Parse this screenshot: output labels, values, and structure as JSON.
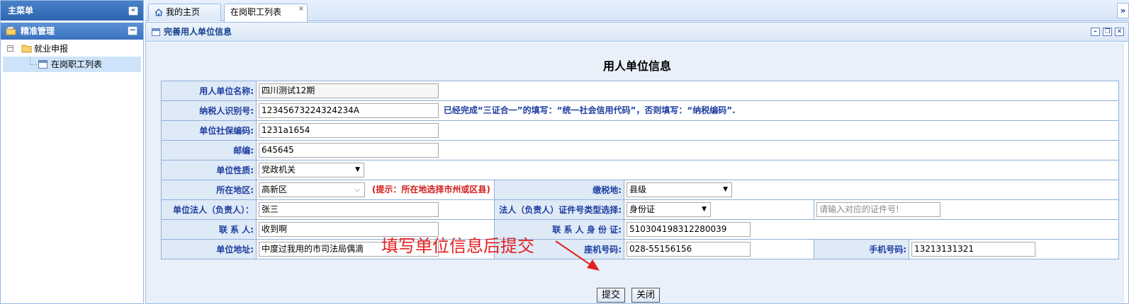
{
  "sidebar": {
    "title": "主菜单",
    "section": "精准管理",
    "tree": [
      {
        "label": "就业申报",
        "toggle": "−"
      },
      {
        "label": "在岗职工列表"
      }
    ]
  },
  "tabs": [
    {
      "label": "我的主页"
    },
    {
      "label": "在岗职工列表"
    }
  ],
  "window": {
    "title": "完善用人单位信息"
  },
  "form": {
    "heading": "用人单位信息",
    "rows": {
      "company_name": {
        "label": "用人单位名称:",
        "value": "四川测试12期"
      },
      "taxpayer_id": {
        "label": "纳税人识别号:",
        "value": "12345673224324234A",
        "hint": "已经完成“三证合一”的填写：“统一社会信用代码”，否则填写：“纳税编码”."
      },
      "social_security_code": {
        "label": "单位社保编码:",
        "value": "1231a1654"
      },
      "postcode": {
        "label": "邮编:",
        "value": "645645"
      },
      "unit_type": {
        "label": "单位性质:",
        "value": "党政机关"
      },
      "region": {
        "label": "所在地区:",
        "value": "高新区",
        "hint": "(提示：所在地选择市州或区县)"
      },
      "tax_place": {
        "label": "缴税地:",
        "value": "县级"
      },
      "legal_person": {
        "label": "单位法人（负责人）：",
        "value": "张三"
      },
      "id_type": {
        "label": "法人（负责人）证件号类型选择:",
        "value": "身份证"
      },
      "id_number": {
        "placeholder": "请输入对应的证件号!"
      },
      "contact": {
        "label": "联 系 人:",
        "value": "收到啊"
      },
      "contact_id": {
        "label": "联 系 人 身 份 证:",
        "value": "510304198312280039"
      },
      "address": {
        "label": "单位地址:",
        "value": "中度过我用的市司法局偶滴"
      },
      "landline": {
        "label": "座机号码:",
        "value": "028-55156156"
      },
      "mobile": {
        "label": "手机号码:",
        "value": "13213131321"
      }
    },
    "buttons": {
      "submit": "提交",
      "close": "关闭"
    }
  },
  "annotation": {
    "text": "填写单位信息后提交",
    "color": "#e12121"
  },
  "colors": {
    "label_text": "#1f3ea0",
    "label_bg": "#dfeaf7",
    "hint_red": "#d21f1f",
    "border": "#99bbe8"
  }
}
